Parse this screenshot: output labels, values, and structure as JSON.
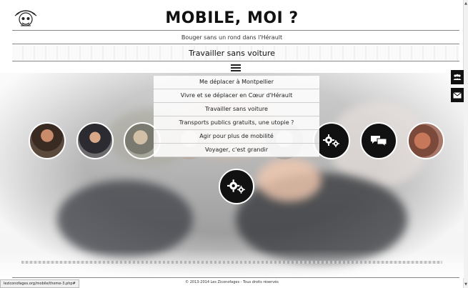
{
  "header": {
    "title": "MOBILE, MOI ?",
    "tagline": "Bouger sans un rond dans l'Hérault",
    "section_title": "Travailler sans voiture"
  },
  "menu": {
    "items": [
      {
        "label": "Me déplacer à Montpellier"
      },
      {
        "label": "Vivre et se déplacer en Cœur d'Hérault"
      },
      {
        "label": "Travailler sans voiture"
      },
      {
        "label": "Transports publics gratuits, une utopie ?"
      },
      {
        "label": "Agir pour plus de mobilité"
      },
      {
        "label": "Voyager, c'est grandir"
      }
    ]
  },
  "circles": [
    {
      "kind": "portrait"
    },
    {
      "kind": "portrait"
    },
    {
      "kind": "portrait"
    },
    {
      "kind": "portrait"
    },
    {
      "kind": "portrait"
    },
    {
      "kind": "icon",
      "icon": "gears-icon"
    },
    {
      "kind": "icon",
      "icon": "chat-bubbles-icon"
    },
    {
      "kind": "portrait"
    }
  ],
  "side_tabs": [
    {
      "icon": "people-icon"
    },
    {
      "icon": "mail-icon"
    }
  ],
  "center_button": {
    "icon": "gears-icon"
  },
  "footer": {
    "copyright": "© 2013-2014 Les Ziconofages - Tous droits réservés"
  },
  "statusbar": {
    "url": "leziconofages.org/mobile/theme-3.php#"
  },
  "colors": {
    "icon_bg": "#111111",
    "text": "#222222",
    "divider": "#888888"
  }
}
